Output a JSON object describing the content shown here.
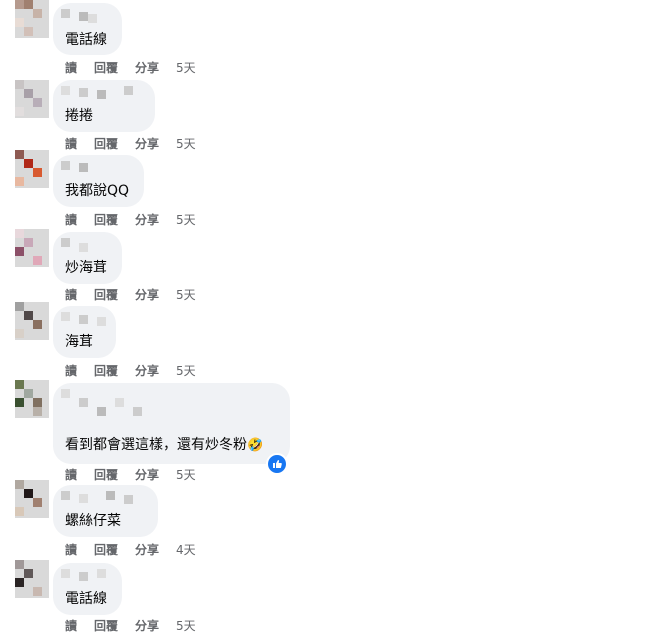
{
  "colors": {
    "bubble": "#f0f2f5",
    "action_text": "#65676b",
    "like_blue": "#1877f2"
  },
  "comments": [
    {
      "text": "電話線",
      "actions": {
        "read": "讀",
        "reply": "回覆",
        "share": "分享",
        "time": "5天"
      }
    },
    {
      "text": "捲捲",
      "actions": {
        "read": "讀",
        "reply": "回覆",
        "share": "分享",
        "time": "5天"
      }
    },
    {
      "text": "我都說QQ",
      "actions": {
        "read": "讀",
        "reply": "回覆",
        "share": "分享",
        "time": "5天"
      }
    },
    {
      "text": "炒海茸",
      "actions": {
        "read": "讀",
        "reply": "回覆",
        "share": "分享",
        "time": "5天"
      }
    },
    {
      "text": "海茸",
      "actions": {
        "read": "讀",
        "reply": "回覆",
        "share": "分享",
        "time": "5天"
      }
    },
    {
      "text": "看到都會選這樣，還有炒冬粉",
      "emoji": "🤣",
      "reaction_icon": "like-icon",
      "actions": {
        "read": "讀",
        "reply": "回覆",
        "share": "分享",
        "time": "5天"
      }
    },
    {
      "text": "螺絲仔菜",
      "actions": {
        "read": "讀",
        "reply": "回覆",
        "share": "分享",
        "time": "4天"
      }
    },
    {
      "text": "電話線",
      "actions": {
        "read": "讀",
        "reply": "回覆",
        "share": "分享",
        "time": "5天"
      }
    }
  ]
}
